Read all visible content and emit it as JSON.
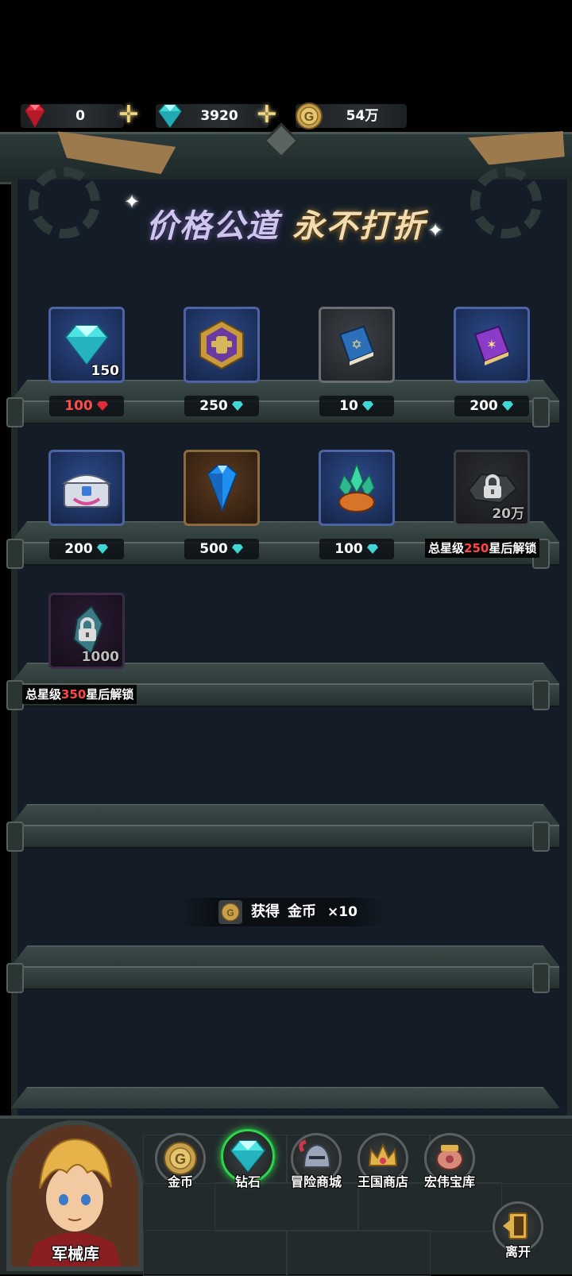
{
  "top_bar": {
    "ruby_amount": "0",
    "diamond_amount": "3920",
    "gold_amount": "54万"
  },
  "banner": {
    "title_part1": "价格公道",
    "title_part2": "永不打折"
  },
  "shop_items": [
    {
      "name": "diamond-pack",
      "quantity": "150",
      "price": "100",
      "currency": "ruby"
    },
    {
      "name": "purple-emblem",
      "quantity": "",
      "price": "250",
      "currency": "diamond"
    },
    {
      "name": "blue-book",
      "quantity": "",
      "price": "10",
      "currency": "diamond"
    },
    {
      "name": "purple-book",
      "quantity": "",
      "price": "200",
      "currency": "diamond"
    },
    {
      "name": "treasure-chest",
      "quantity": "",
      "price": "200",
      "currency": "diamond"
    },
    {
      "name": "blue-crystal",
      "quantity": "",
      "price": "500",
      "currency": "diamond"
    },
    {
      "name": "crystal-cluster",
      "quantity": "",
      "price": "100",
      "currency": "diamond"
    },
    {
      "name": "locked-ore",
      "quantity": "20万",
      "unlock_prefix": "总星级",
      "unlock_number": "250",
      "unlock_suffix": "星后解锁"
    },
    {
      "name": "locked-shard",
      "quantity": "1000",
      "unlock_prefix": "总星级",
      "unlock_number": "350",
      "unlock_suffix": "星后解锁"
    }
  ],
  "toast": {
    "label": "获得",
    "item": "金币",
    "count": "×10"
  },
  "bottom_nav": {
    "armory": "军械库",
    "tabs": [
      "金币",
      "钻石",
      "冒险商城",
      "王国商店",
      "宏伟宝库"
    ],
    "active_tab": "钻石",
    "exit": "离开"
  },
  "colors": {
    "diamond": "#3fd6d6",
    "ruby": "#e02a3a",
    "gold": "#d8b25a",
    "active": "#2cd84a",
    "unlock_number": "#ff4646"
  }
}
